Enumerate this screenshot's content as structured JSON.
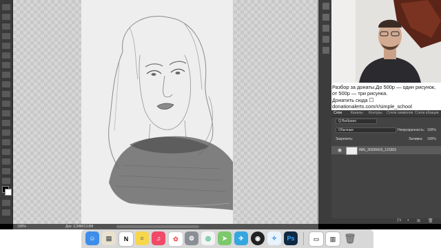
{
  "app": {
    "zoom": "100%",
    "doc_info": "Док: 3,34М/13,8М"
  },
  "stream_overlay": {
    "line1": "Разбор за донаты.До 500р — один рисунок,",
    "line2": "от 500р — три рисунка.",
    "line3": "Донатить сюда ☐",
    "line4": "donationalerts.com/r/simple_school"
  },
  "layers_panel": {
    "tabs": [
      "Слои",
      "Каналы",
      "Контуры",
      "Стили символов",
      "Стили абзацев"
    ],
    "filter_label": "Q Выбрано",
    "blend_mode": "Обычные",
    "opacity_label": "Непрозрачность:",
    "opacity_value": "100%",
    "lock_label": "Закрепить:",
    "fill_label": "Заливка:",
    "fill_value": "100%",
    "layer_name": "IMG_20200415_123303"
  },
  "dock": {
    "items": [
      "finder",
      "preview",
      "notion",
      "notes",
      "music",
      "photos",
      "system-preferences",
      "chrome",
      "maps",
      "telegram",
      "obs",
      "safari",
      "photoshop",
      "documents",
      "trash"
    ],
    "ps_label": "Ps"
  }
}
